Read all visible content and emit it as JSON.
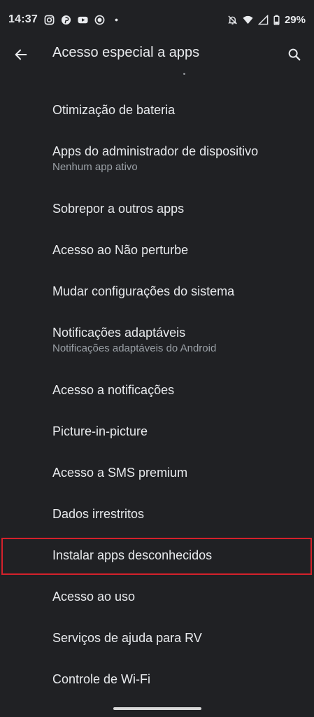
{
  "status_bar": {
    "time": "14:37",
    "battery": "29%",
    "left_icons": [
      "instagram-icon",
      "pinterest-icon",
      "youtube-icon",
      "circle-app-icon",
      "dot-icon"
    ],
    "right_icons": [
      "bell-off-icon",
      "wifi-icon",
      "signal-icon",
      "battery-icon"
    ]
  },
  "app_bar": {
    "back_icon": "arrow-left-icon",
    "title": "Acesso especial a apps",
    "search_icon": "search-icon"
  },
  "items": [
    {
      "id": "otimizacao-bateria",
      "title": "Otimização de bateria"
    },
    {
      "id": "apps-administrador",
      "title": "Apps do administrador de dispositivo",
      "summary": "Nenhum app ativo"
    },
    {
      "id": "sobrepor-apps",
      "title": "Sobrepor a outros apps"
    },
    {
      "id": "nao-perturbe",
      "title": "Acesso ao Não perturbe"
    },
    {
      "id": "configuracoes-sistema",
      "title": "Mudar configurações do sistema"
    },
    {
      "id": "notificacoes-adaptaveis",
      "title": "Notificações adaptáveis",
      "summary": "Notificações adaptáveis do Android"
    },
    {
      "id": "acesso-notificacoes",
      "title": "Acesso a notificações"
    },
    {
      "id": "picture-in-picture",
      "title": "Picture-in-picture"
    },
    {
      "id": "sms-premium",
      "title": "Acesso a SMS premium"
    },
    {
      "id": "dados-irrestritos",
      "title": "Dados irrestritos"
    },
    {
      "id": "instalar-apps-desconhecidos",
      "title": "Instalar apps desconhecidos",
      "highlighted": true
    },
    {
      "id": "acesso-uso",
      "title": "Acesso ao uso"
    },
    {
      "id": "servicos-rv",
      "title": "Serviços de ajuda para RV"
    },
    {
      "id": "controle-wifi",
      "title": "Controle de Wi-Fi"
    }
  ],
  "colors": {
    "background": "#202124",
    "text_primary": "#e8eaed",
    "text_secondary": "#9aa0a6",
    "highlight": "#d4212b"
  }
}
